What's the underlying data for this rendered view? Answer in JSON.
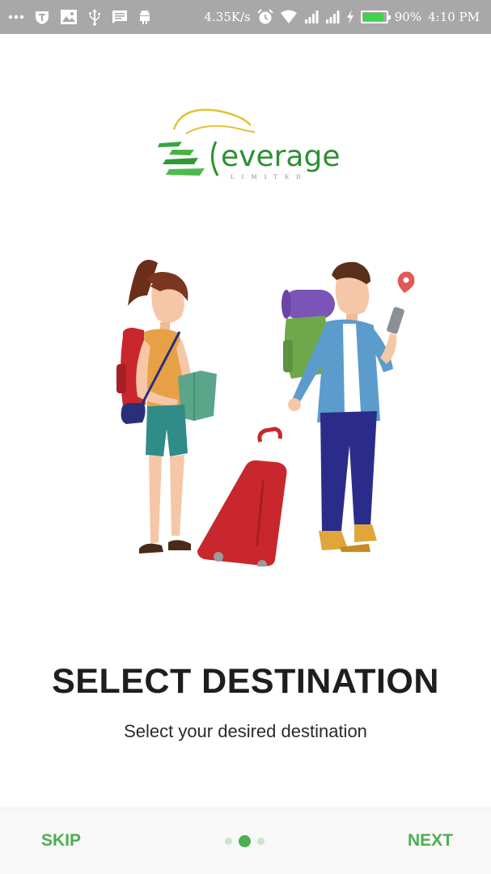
{
  "status_bar": {
    "network_speed": "4.35K/s",
    "battery_percent": "90%",
    "battery_level": 0.9,
    "time": "4:10 PM",
    "battery_color": "#3fd24c",
    "icons": [
      "more-icon",
      "vpn-icon",
      "gallery-icon",
      "usb-icon",
      "message-icon",
      "android-icon",
      "alarm-icon",
      "wifi-icon",
      "signal-icon",
      "signal-icon",
      "charging-icon",
      "battery-icon"
    ]
  },
  "logo": {
    "brand": "everage",
    "tagline": "LIMITED"
  },
  "onboarding": {
    "title": "SELECT DESTINATION",
    "subtitle": "Select your desired destination",
    "page_index": 2,
    "page_count": 3
  },
  "footer": {
    "skip_label": "SKIP",
    "next_label": "NEXT",
    "accent_color": "#4caf50"
  }
}
